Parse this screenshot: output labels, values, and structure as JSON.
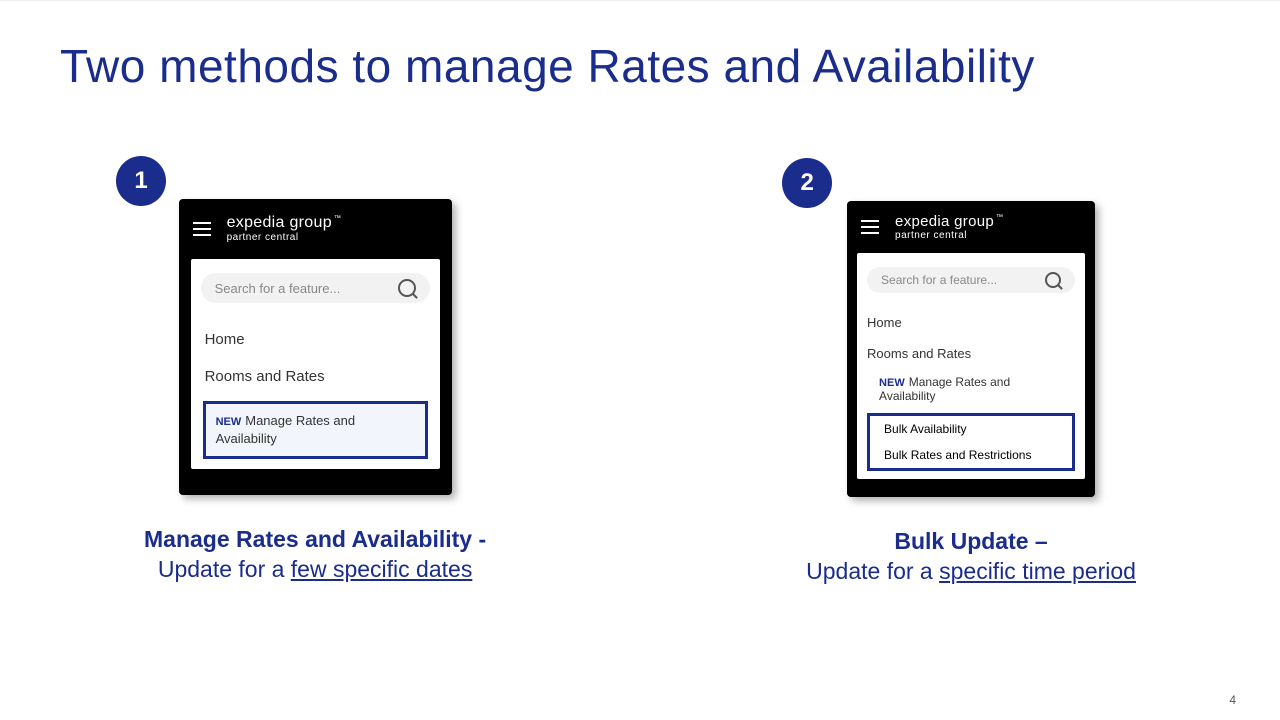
{
  "title": "Two methods to manage Rates and Availability",
  "page_number": "4",
  "methods": [
    {
      "badge": "1",
      "brand_top": "expedia group",
      "brand_bot": "partner central",
      "search_placeholder": "Search for a feature...",
      "menu": {
        "home": "Home",
        "rooms": "Rooms and Rates"
      },
      "highlight": {
        "new": "NEW",
        "label": "Manage Rates and Availability"
      },
      "caption_title": "Manage Rates and Availability -",
      "caption_pre": "Update for a ",
      "caption_und": "few specific dates"
    },
    {
      "badge": "2",
      "brand_top": "expedia group",
      "brand_bot": "partner central",
      "search_placeholder": "Search for a feature...",
      "menu": {
        "home": "Home",
        "rooms": "Rooms and Rates"
      },
      "sub": {
        "new": "NEW",
        "manage": "Manage Rates and Availability",
        "bulk_avail": "Bulk Availability",
        "bulk_rates": "Bulk Rates and Restrictions"
      },
      "caption_title": "Bulk Update –",
      "caption_pre": "Update for a ",
      "caption_und": "specific time period"
    }
  ]
}
